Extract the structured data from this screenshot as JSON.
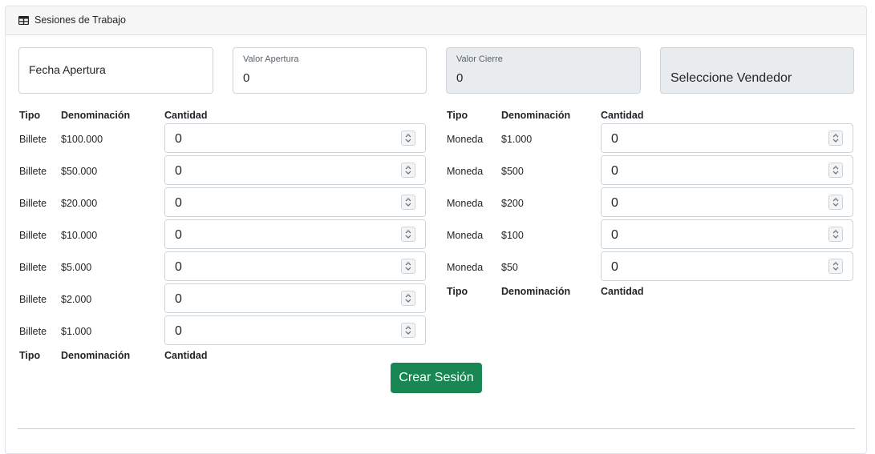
{
  "header": {
    "title": "Sesiones de Trabajo",
    "icon": "table-icon"
  },
  "form": {
    "fecha_apertura_label": "Fecha Apertura",
    "valor_apertura_label": "Valor Apertura",
    "valor_apertura_value": "0",
    "valor_cierre_label": "Valor Cierre",
    "valor_cierre_value": "0",
    "vendedor_selected": "Seleccione Vendedor"
  },
  "columns": {
    "tipo": "Tipo",
    "denominacion": "Denominación",
    "cantidad": "Cantidad"
  },
  "billetes": [
    {
      "tipo": "Billete",
      "denominacion": "$100.000",
      "cantidad": "0"
    },
    {
      "tipo": "Billete",
      "denominacion": "$50.000",
      "cantidad": "0"
    },
    {
      "tipo": "Billete",
      "denominacion": "$20.000",
      "cantidad": "0"
    },
    {
      "tipo": "Billete",
      "denominacion": "$10.000",
      "cantidad": "0"
    },
    {
      "tipo": "Billete",
      "denominacion": "$5.000",
      "cantidad": "0"
    },
    {
      "tipo": "Billete",
      "denominacion": "$2.000",
      "cantidad": "0"
    },
    {
      "tipo": "Billete",
      "denominacion": "$1.000",
      "cantidad": "0"
    }
  ],
  "monedas": [
    {
      "tipo": "Moneda",
      "denominacion": "$1.000",
      "cantidad": "0"
    },
    {
      "tipo": "Moneda",
      "denominacion": "$500",
      "cantidad": "0"
    },
    {
      "tipo": "Moneda",
      "denominacion": "$200",
      "cantidad": "0"
    },
    {
      "tipo": "Moneda",
      "denominacion": "$100",
      "cantidad": "0"
    },
    {
      "tipo": "Moneda",
      "denominacion": "$50",
      "cantidad": "0"
    }
  ],
  "actions": {
    "create_label": "Crear Sesión"
  },
  "colors": {
    "primary_button": "#198754",
    "disabled_field": "#e9ecef",
    "header_bg": "#f7f7f7"
  }
}
